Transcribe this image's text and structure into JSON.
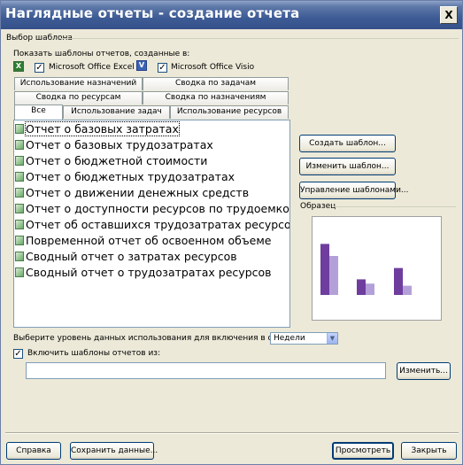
{
  "window": {
    "title": "Наглядные отчеты - создание отчета",
    "close_label": "X"
  },
  "template_group": {
    "label": "Выбор шаблона",
    "show_label": "Показать шаблоны отчетов, созданные в:",
    "excel": {
      "checked": true,
      "label": "Microsoft Office Excel",
      "icon": "excel-icon"
    },
    "visio": {
      "checked": true,
      "label": "Microsoft Office Visio",
      "icon": "visio-icon"
    }
  },
  "tabs": {
    "row1": [
      "Использование назначений",
      "Сводка по задачам"
    ],
    "row2": [
      "Сводка по ресурсам",
      "Сводка по назначениям"
    ],
    "row3": [
      "Все",
      "Использование задач",
      "Использование ресурсов"
    ],
    "active": "Все"
  },
  "reports": [
    "Отчет о базовых затратах",
    "Отчет о базовых трудозатратах",
    "Отчет о бюджетной стоимости",
    "Отчет о бюджетных трудозатратах",
    "Отчет о движении денежных средств",
    "Отчет о доступности ресурсов по трудоемкости",
    "Отчет об оставшихся трудозатратах ресурсов",
    "Повременной отчет об освоенном объеме",
    "Сводный отчет о затратах ресурсов",
    "Сводный отчет о трудозатратах ресурсов"
  ],
  "side_buttons": {
    "new_template": "Создать шаблон...",
    "edit_template": "Изменить шаблон...",
    "manage_templates": "Управление шаблонами..."
  },
  "sample": {
    "label": "Образец",
    "groups": [
      {
        "values": [
          0.72,
          0.55
        ]
      },
      {
        "values": [
          0.22,
          0.16
        ]
      },
      {
        "values": [
          0.38,
          0.13
        ]
      }
    ]
  },
  "usage_level": {
    "label": "Выберите уровень данных использования для включения в отчет:",
    "value": "Недели"
  },
  "include": {
    "checked": true,
    "label": "Включить шаблоны отчетов из:",
    "path": "",
    "change_button": "Изменить..."
  },
  "footer": {
    "help": "Справка",
    "save_data": "Сохранить данные...",
    "view": "Просмотреть",
    "close": "Закрыть"
  }
}
